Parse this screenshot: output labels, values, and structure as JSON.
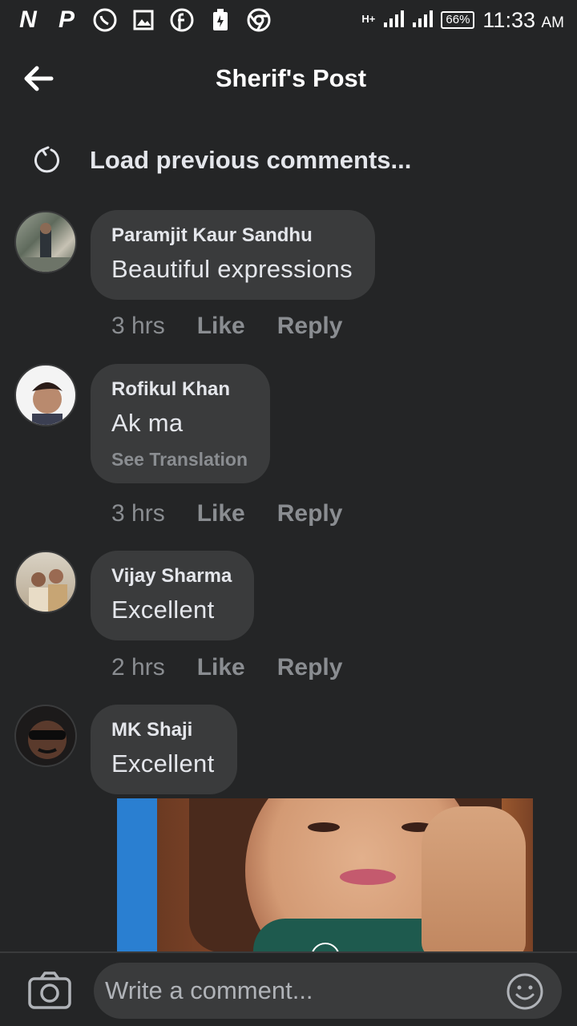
{
  "status_bar": {
    "icons": [
      "netflix-icon",
      "pocket-icon",
      "whatsapp-icon",
      "gallery-icon",
      "facebook-icon",
      "battery-saver-icon",
      "chrome-icon"
    ],
    "network": "H+",
    "battery": "66%",
    "time": "11:33",
    "ampm": "AM"
  },
  "header": {
    "title": "Sherif's Post",
    "back_icon": "arrow-left-icon"
  },
  "load_previous": {
    "label": "Load previous comments...",
    "icon": "refresh-icon"
  },
  "comments": [
    {
      "author": "Paramjit Kaur Sandhu",
      "text": "Beautiful  expressions",
      "time": "3 hrs",
      "like": "Like",
      "reply": "Reply"
    },
    {
      "author": "Rofikul Khan",
      "text": "Ak ma",
      "see_translation": "See Translation",
      "time": "3 hrs",
      "like": "Like",
      "reply": "Reply"
    },
    {
      "author": "Vijay Sharma",
      "text": "Excellent",
      "time": "2 hrs",
      "like": "Like",
      "reply": "Reply"
    },
    {
      "author": "MK Shaji",
      "text": "Excellent"
    }
  ],
  "composer": {
    "placeholder": "Write a comment...",
    "camera_icon": "camera-icon",
    "emoji_icon": "emoji-icon"
  },
  "colors": {
    "background": "#242526",
    "bubble": "#3a3b3c",
    "primary_text": "#e4e6eb",
    "secondary_text": "#8a8d91"
  }
}
